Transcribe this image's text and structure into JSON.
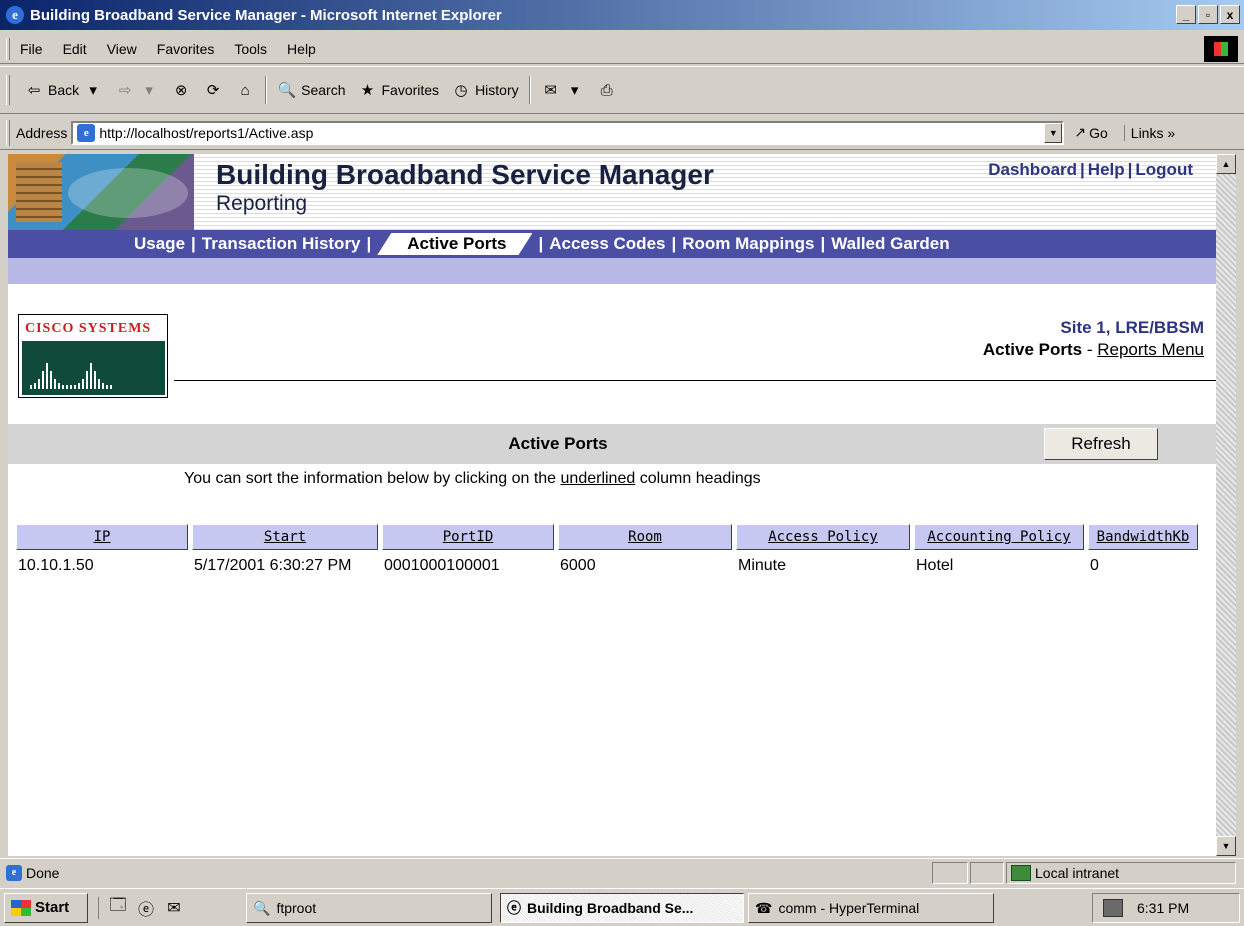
{
  "window": {
    "title": "Building Broadband Service Manager - Microsoft Internet Explorer",
    "controls": [
      "_",
      "▫",
      "x"
    ]
  },
  "menu": [
    "File",
    "Edit",
    "View",
    "Favorites",
    "Tools",
    "Help"
  ],
  "toolbar": {
    "back": "Back",
    "search": "Search",
    "favorites": "Favorites",
    "history": "History"
  },
  "address": {
    "label": "Address",
    "url": "http://localhost/reports1/Active.asp",
    "go": "Go",
    "links": "Links »"
  },
  "header": {
    "title": "Building Broadband Service Manager",
    "subtitle": "Reporting",
    "links": [
      "Dashboard",
      "Help",
      "Logout"
    ]
  },
  "nav": {
    "items": [
      "Usage",
      "Transaction History",
      "Active Ports",
      "Access Codes",
      "Room Mappings",
      "Walled Garden"
    ],
    "active": "Active Ports"
  },
  "logo": {
    "text": "CISCO SYSTEMS"
  },
  "site": {
    "name": "Site 1, LRE/BBSM",
    "page": "Active Ports",
    "sep": " - ",
    "reports_menu": "Reports Menu"
  },
  "section": {
    "title": "Active Ports",
    "refresh": "Refresh",
    "hint_before": "You can sort the information below by clicking on the ",
    "hint_link": "underlined",
    "hint_after": " column headings"
  },
  "table": {
    "columns": [
      "IP",
      "Start",
      "PortID",
      "Room",
      "Access Policy",
      "Accounting Policy",
      "BandwidthKb"
    ],
    "rows": [
      [
        "10.10.1.50",
        "5/17/2001 6:30:27 PM",
        "0001000100001",
        "6000",
        "Minute",
        "Hotel",
        "0"
      ]
    ]
  },
  "status": {
    "text": "Done",
    "zone": "Local intranet"
  },
  "taskbar": {
    "start": "Start",
    "tasks": [
      "ftproot",
      "Building Broadband Se...",
      "comm - HyperTerminal"
    ],
    "clock": "6:31 PM"
  }
}
